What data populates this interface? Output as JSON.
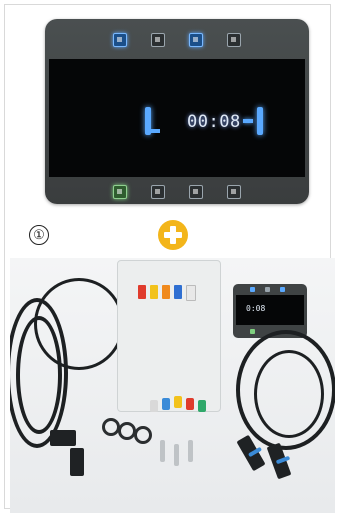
{
  "display": {
    "time": "00:08",
    "top_icons": [
      "power-icon",
      "menu-icon",
      "flag-icon",
      "image-icon"
    ],
    "bottom_icons": [
      "check-icon",
      "inbox-icon",
      "tray-icon",
      "alert-icon"
    ]
  },
  "step": {
    "number": "①"
  },
  "kit_photo": {
    "mini_display_time": "0:08"
  },
  "colors": {
    "accent_blue": "#5aa9ff",
    "plus_orange": "#f3b51a",
    "panel_gray": "#464a4b"
  }
}
